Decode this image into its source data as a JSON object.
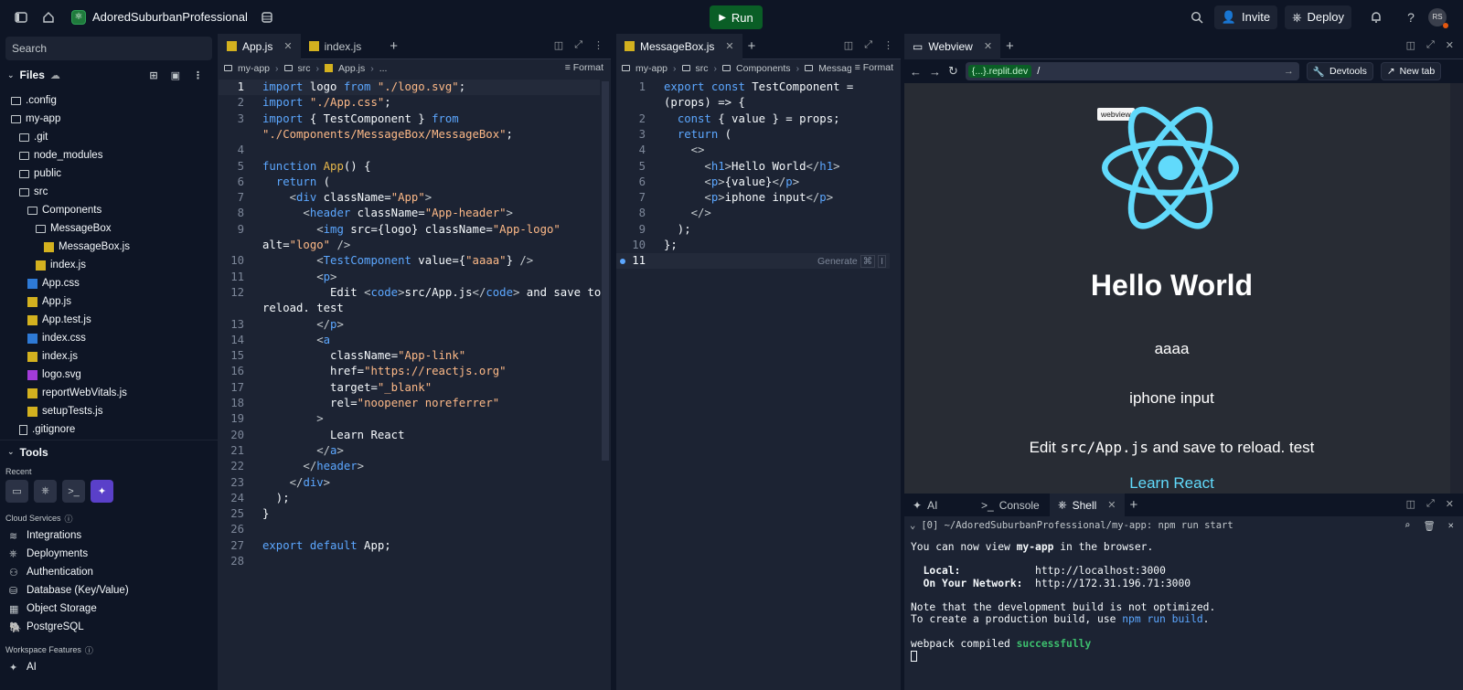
{
  "topbar": {
    "repl_name": "AdoredSuburbanProfessional",
    "run_label": "Run",
    "invite_label": "Invite",
    "deploy_label": "Deploy",
    "avatar_initials": "RS"
  },
  "sidebar": {
    "search_placeholder": "Search",
    "files_label": "Files",
    "tree": [
      {
        "label": ".config",
        "type": "folder",
        "depth": 0
      },
      {
        "label": "my-app",
        "type": "folder",
        "depth": 0
      },
      {
        "label": ".git",
        "type": "folder",
        "depth": 1
      },
      {
        "label": "node_modules",
        "type": "folder",
        "depth": 1
      },
      {
        "label": "public",
        "type": "folder",
        "depth": 1
      },
      {
        "label": "src",
        "type": "folder",
        "depth": 1
      },
      {
        "label": "Components",
        "type": "folder",
        "depth": 2
      },
      {
        "label": "MessageBox",
        "type": "folder",
        "depth": 3
      },
      {
        "label": "MessageBox.js",
        "type": "js",
        "depth": 4
      },
      {
        "label": "index.js",
        "type": "js",
        "depth": 3
      },
      {
        "label": "App.css",
        "type": "css",
        "depth": 2
      },
      {
        "label": "App.js",
        "type": "js",
        "depth": 2
      },
      {
        "label": "App.test.js",
        "type": "js",
        "depth": 2
      },
      {
        "label": "index.css",
        "type": "css",
        "depth": 2
      },
      {
        "label": "index.js",
        "type": "js",
        "depth": 2
      },
      {
        "label": "logo.svg",
        "type": "svg",
        "depth": 2
      },
      {
        "label": "reportWebVitals.js",
        "type": "js",
        "depth": 2
      },
      {
        "label": "setupTests.js",
        "type": "js",
        "depth": 2
      },
      {
        "label": ".gitignore",
        "type": "file",
        "depth": 1
      }
    ],
    "tools_label": "Tools",
    "recent_label": "Recent",
    "cloud_label": "Cloud Services",
    "services": [
      "Integrations",
      "Deployments",
      "Authentication",
      "Database (Key/Value)",
      "Object Storage",
      "PostgreSQL"
    ],
    "workspace_label": "Workspace Features",
    "workspace_items": [
      "AI"
    ]
  },
  "editor1": {
    "tabs": [
      "App.js",
      "index.js"
    ],
    "breadcrumb": [
      "my-app",
      "src",
      "App.js",
      "..."
    ],
    "format_label": "Format",
    "current_line": "1",
    "lines": [
      {
        "n": "1",
        "html": "<span class='kw'>import</span> logo <span class='kw'>from</span> <span class='str'>\"./logo.svg\"</span>;"
      },
      {
        "n": "2",
        "html": "<span class='kw'>import</span> <span class='str'>\"./App.css\"</span>;"
      },
      {
        "n": "3",
        "html": "<span class='kw'>import</span> { TestComponent } <span class='kw'>from</span>"
      },
      {
        "n": "",
        "html": "<span class='str'>\"./Components/MessageBox/MessageBox\"</span>;"
      },
      {
        "n": "4",
        "html": ""
      },
      {
        "n": "5",
        "html": "<span class='kw'>function</span> <span class='fn'>App</span>() {"
      },
      {
        "n": "6",
        "html": "  <span class='kw'>return</span> ("
      },
      {
        "n": "7",
        "html": "    <span class='br'>&lt;</span><span class='tag'>div</span> <span class='at'>className</span>=<span class='str'>\"App\"</span><span class='br'>&gt;</span>"
      },
      {
        "n": "8",
        "html": "      <span class='br'>&lt;</span><span class='tag'>header</span> <span class='at'>className</span>=<span class='str'>\"App-header\"</span><span class='br'>&gt;</span>"
      },
      {
        "n": "9",
        "html": "        <span class='br'>&lt;</span><span class='tag'>img</span> <span class='at'>src</span>={logo} <span class='at'>className</span>=<span class='str'>\"App-logo\"</span>"
      },
      {
        "n": "",
        "html": "<span class='at'>alt</span>=<span class='str'>\"logo\"</span> <span class='br'>/&gt;</span>"
      },
      {
        "n": "10",
        "html": "        <span class='br'>&lt;</span><span class='tag'>TestComponent</span> <span class='at'>value</span>={<span class='str'>\"aaaa\"</span>} <span class='br'>/&gt;</span>"
      },
      {
        "n": "11",
        "html": "        <span class='br'>&lt;</span><span class='tag'>p</span><span class='br'>&gt;</span>"
      },
      {
        "n": "12",
        "html": "          Edit <span class='br'>&lt;</span><span class='tag'>code</span><span class='br'>&gt;</span>src/App.js<span class='br'>&lt;/</span><span class='tag'>code</span><span class='br'>&gt;</span> and save to"
      },
      {
        "n": "",
        "html": "reload. test"
      },
      {
        "n": "13",
        "html": "        <span class='br'>&lt;/</span><span class='tag'>p</span><span class='br'>&gt;</span>"
      },
      {
        "n": "14",
        "html": "        <span class='br'>&lt;</span><span class='tag'>a</span>"
      },
      {
        "n": "15",
        "html": "          <span class='at'>className</span>=<span class='str'>\"App-link\"</span>"
      },
      {
        "n": "16",
        "html": "          <span class='at'>href</span>=<span class='str'>\"https://reactjs.org\"</span>"
      },
      {
        "n": "17",
        "html": "          <span class='at'>target</span>=<span class='str'>\"_blank\"</span>"
      },
      {
        "n": "18",
        "html": "          <span class='at'>rel</span>=<span class='str'>\"noopener noreferrer\"</span>"
      },
      {
        "n": "19",
        "html": "        <span class='br'>&gt;</span>"
      },
      {
        "n": "20",
        "html": "          Learn React"
      },
      {
        "n": "21",
        "html": "        <span class='br'>&lt;/</span><span class='tag'>a</span><span class='br'>&gt;</span>"
      },
      {
        "n": "22",
        "html": "      <span class='br'>&lt;/</span><span class='tag'>header</span><span class='br'>&gt;</span>"
      },
      {
        "n": "23",
        "html": "    <span class='br'>&lt;/</span><span class='tag'>div</span><span class='br'>&gt;</span>"
      },
      {
        "n": "24",
        "html": "  );"
      },
      {
        "n": "25",
        "html": "}"
      },
      {
        "n": "26",
        "html": ""
      },
      {
        "n": "27",
        "html": "<span class='kw'>export</span> <span class='kw'>default</span> App;"
      },
      {
        "n": "28",
        "html": ""
      }
    ]
  },
  "editor2": {
    "tabs": [
      "MessageBox.js"
    ],
    "breadcrumb": [
      "my-app",
      "src",
      "Components",
      "MessageBox"
    ],
    "format_label": "Format",
    "generate_label": "Generate",
    "current_line": "11",
    "lines": [
      {
        "n": "1",
        "html": "<span class='kw'>export</span> <span class='kw'>const</span> TestComponent ="
      },
      {
        "n": "",
        "html": "(props) =&gt; {"
      },
      {
        "n": "2",
        "html": "  <span class='kw'>const</span> { value } = props;"
      },
      {
        "n": "3",
        "html": "  <span class='kw'>return</span> ("
      },
      {
        "n": "4",
        "html": "    <span class='br'>&lt;&gt;</span>"
      },
      {
        "n": "5",
        "html": "      <span class='br'>&lt;</span><span class='tag'>h1</span><span class='br'>&gt;</span>Hello World<span class='br'>&lt;/</span><span class='tag'>h1</span><span class='br'>&gt;</span>"
      },
      {
        "n": "6",
        "html": "      <span class='br'>&lt;</span><span class='tag'>p</span><span class='br'>&gt;</span>{value}<span class='br'>&lt;/</span><span class='tag'>p</span><span class='br'>&gt;</span>"
      },
      {
        "n": "7",
        "html": "      <span class='br'>&lt;</span><span class='tag'>p</span><span class='br'>&gt;</span>iphone input<span class='br'>&lt;/</span><span class='tag'>p</span><span class='br'>&gt;</span>"
      },
      {
        "n": "8",
        "html": "    <span class='br'>&lt;/&gt;</span>"
      },
      {
        "n": "9",
        "html": "  );"
      },
      {
        "n": "10",
        "html": "};"
      },
      {
        "n": "11",
        "html": ""
      }
    ]
  },
  "webview": {
    "tab_label": "Webview",
    "url_domain": "{...}.replit.dev",
    "url_path": "/",
    "devtools_label": "Devtools",
    "newtab_label": "New tab",
    "tooltip": "webview",
    "heading": "Hello World",
    "p1": "aaaa",
    "p2": "iphone input",
    "edit_prefix": "Edit ",
    "edit_code": "src/App.js",
    "edit_suffix": " and save to reload. test",
    "link": "Learn React"
  },
  "shell": {
    "tabs": [
      "AI",
      "Console",
      "Shell"
    ],
    "command": "[0] ~/AdoredSuburbanProfessional/my-app: npm run start",
    "out1_pre": "You can now view ",
    "out1_app": "my-app",
    "out1_post": " in the browser.",
    "local_label": "Local:",
    "local_url": "http://localhost:3000",
    "net_label": "On Your Network:",
    "net_url": "http://172.31.196.71:3000",
    "note1": "Note that the development build is not optimized.",
    "note2_pre": "To create a production build, use ",
    "note2_cmd": "npm run build",
    "note2_post": ".",
    "compiled_pre": "webpack compiled ",
    "compiled_status": "successfully"
  },
  "colors": {
    "accent_run": "#0a5e26",
    "react_blue": "#61dafb",
    "link": "#61dafb"
  }
}
